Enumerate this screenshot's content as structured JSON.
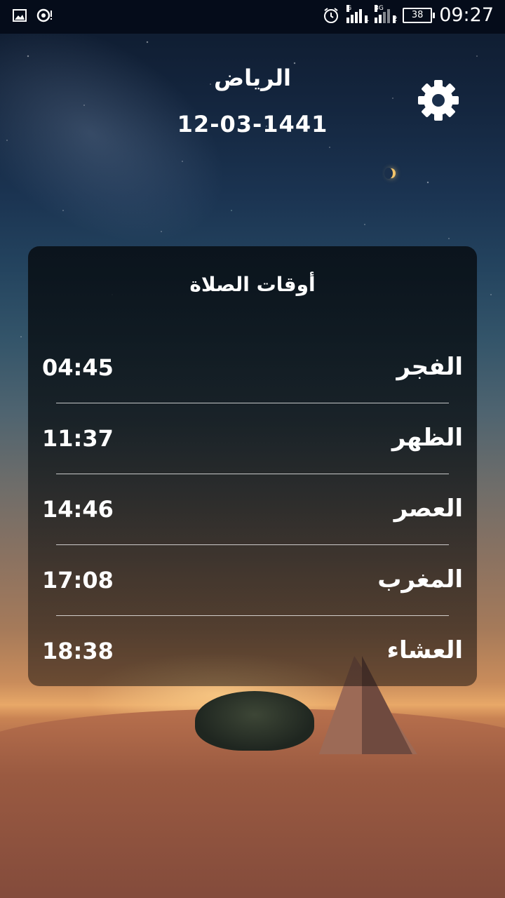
{
  "status_bar": {
    "time": "09:27",
    "battery": "38",
    "network_1_type": "G",
    "network_1_sim": "1",
    "network_2_type": "3G",
    "network_2_sim": "2",
    "icons": [
      "image-icon",
      "sync-alert-icon",
      "alarm-icon",
      "signal-icon",
      "battery-icon"
    ]
  },
  "header": {
    "city": "الرياض",
    "hijri_date": "12-03-1441",
    "settings_icon": "gear-icon"
  },
  "card": {
    "title": "أوقات الصلاة",
    "prayers": [
      {
        "name": "الفجر",
        "time": "04:45"
      },
      {
        "name": "الظهر",
        "time": "11:37"
      },
      {
        "name": "العصر",
        "time": "14:46"
      },
      {
        "name": "المغرب",
        "time": "17:08"
      },
      {
        "name": "العشاء",
        "time": "18:38"
      }
    ]
  },
  "colors": {
    "text": "#ffffff",
    "card_bg": "#0a0f14",
    "sky_top": "#0e1a2d",
    "sand": "#9a5a41"
  }
}
